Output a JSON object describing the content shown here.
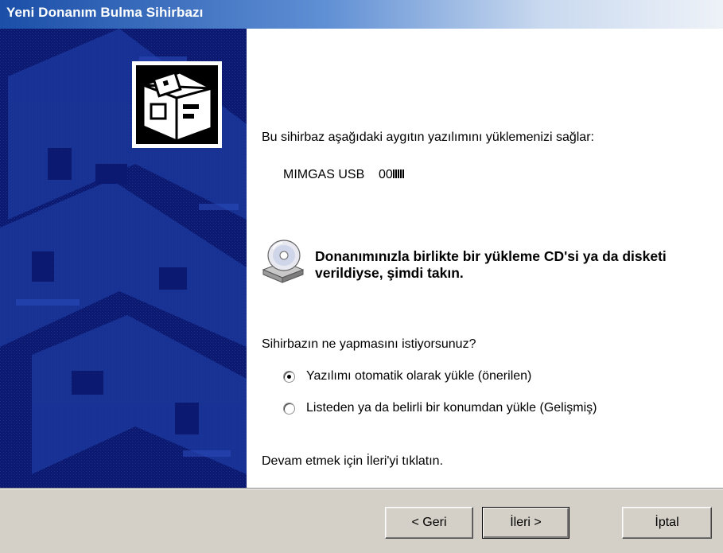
{
  "window": {
    "title": "Yeni Donanım Bulma Sihirbazı"
  },
  "content": {
    "intro": "Bu sihirbaz aşağıdaki aygıtın yazılımını yüklemenizi sağlar:",
    "device_name": "MIMGAS USB    00",
    "cd_prompt": "Donanımınızla birlikte bir yükleme CD'si ya da disketi verildiyse, şimdi takın.",
    "question": "Sihirbazın ne yapmasını istiyorsunuz?",
    "options": [
      {
        "label": "Yazılımı otomatik olarak yükle (önerilen)",
        "selected": true
      },
      {
        "label": "Listeden ya da belirli bir konumdan yükle (Gelişmiş)",
        "selected": false
      }
    ],
    "continue_text": "Devam etmek için İleri'yi tıklatın."
  },
  "buttons": {
    "back": "< Geri",
    "next": "İleri >",
    "cancel": "İptal"
  },
  "colors": {
    "banner_bg": "#0a1a6e",
    "title_start": "#1b4fa8",
    "footer_bg": "#d4d0c8"
  },
  "icons": {
    "banner_icon": "hardware-board-icon",
    "cd_icon": "cd-drive-icon"
  }
}
